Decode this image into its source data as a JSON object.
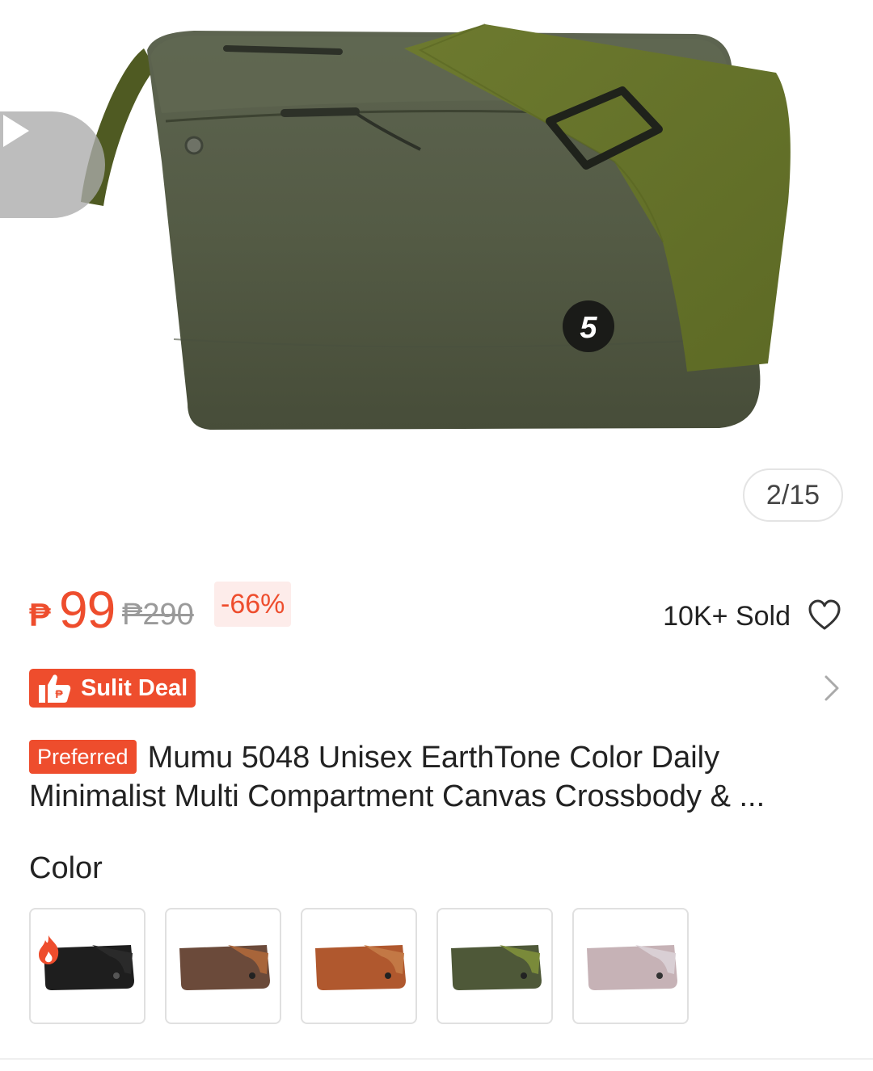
{
  "gallery": {
    "counter": "2/15",
    "play_icon": "play-icon",
    "brand_logo": "5"
  },
  "price": {
    "currency": "₱",
    "current": "99",
    "original": "₱290",
    "discount": "-66%",
    "sold": "10K+ Sold"
  },
  "deal": {
    "label": "Sulit Deal",
    "icon": "thumbs-up-peso-icon"
  },
  "product": {
    "preferred_tag": "Preferred",
    "title": "Mumu 5048 Unisex EarthTone Color Daily Minimalist Multi Compartment Canvas Crossbody & ..."
  },
  "variants": {
    "label": "Color",
    "options": [
      {
        "color": "#1e1e1e",
        "strap": "#2a2a2a",
        "hot": true
      },
      {
        "color": "#6b4a3a",
        "strap": "#a8653a",
        "hot": false
      },
      {
        "color": "#b0582e",
        "strap": "#c37845",
        "hot": false
      },
      {
        "color": "#4e5838",
        "strap": "#7a8a3a",
        "hot": false
      },
      {
        "color": "#c6b2b6",
        "strap": "#d9cfd4",
        "hot": false
      }
    ]
  },
  "colors": {
    "accent": "#ee4d2d",
    "bag_body": "#535b43",
    "strap": "#6b7a2e"
  }
}
